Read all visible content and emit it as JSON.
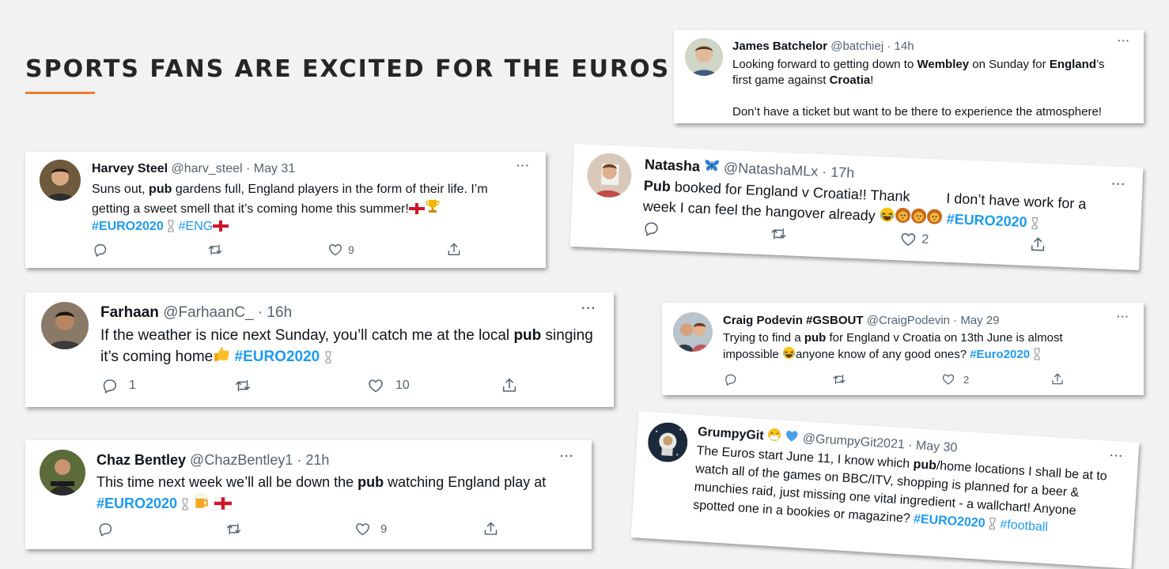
{
  "slide": {
    "title": "SPORTS FANS ARE EXCITED FOR THE EUROS",
    "accent_color": "#ed7d31"
  },
  "tweets": {
    "james": {
      "name": "James Batchelor",
      "handle": "@batchiej",
      "time": "· 14h",
      "t1": "Looking forward to getting down to ",
      "b1": "Wembley",
      "t2": " on Sunday for ",
      "b2": "England",
      "t3": "’s",
      "t4": "first game against ",
      "b3": "Croatia",
      "t5": "!",
      "line3": "Don’t have a ticket but want to be there to experience the atmosphere!"
    },
    "harvey": {
      "name": "Harvey Steel",
      "handle": "@harv_steel",
      "time": "· May 31",
      "t1": "Suns out, ",
      "b1": "pub",
      "t2": " gardens full, England players in the form of their life. I’m",
      "t3": "getting a sweet smell that it’s coming home this summer!",
      "hash1": "#EURO2020",
      "hash2": "#ENG",
      "likes": "9"
    },
    "natasha": {
      "name": "Natasha",
      "handle": "@NatashaMLx",
      "time": "· 17h",
      "b1": "Pub",
      "t1": " booked for England v Croatia!! Thank",
      "t2": "I don’t have work for a",
      "t3": "week I can feel the hangover already ",
      "hash1": "#EURO2020",
      "likes": "2"
    },
    "farhaan": {
      "name": "Farhaan",
      "handle": "@FarhaanC_",
      "time": "· 16h",
      "t1": "If the weather is nice next Sunday, you’ll catch me at the local ",
      "b1": "pub",
      "t2": " singing",
      "t3": "it’s coming home",
      "hash1": "#EURO2020",
      "replies": "1",
      "likes": "10"
    },
    "craig": {
      "name": "Craig Podevin #GSBOUT",
      "handle": "@CraigPodevin",
      "time": "· May 29",
      "t1": "Trying to find a ",
      "b1": "pub",
      "t2": " for England v Croatia on 13th June is almost",
      "t3": "impossible ",
      "t4": "anyone know of any good ones? ",
      "hash1": "#Euro2020",
      "likes": "2"
    },
    "chaz": {
      "name": "Chaz Bentley",
      "handle": "@ChazBentley1",
      "time": "· 21h",
      "t1": "This time next week we’ll all be down the ",
      "b1": "pub",
      "t2": " watching England play at",
      "hash1": "#EURO2020",
      "likes": "9"
    },
    "grumpy": {
      "name": "GrumpyGit",
      "handle": "@GrumpyGit2021",
      "time": "· May 30",
      "l1a": "The Euros start June 11, I know which ",
      "l1b": "pub",
      "l1c": "/home locations I shall be at to",
      "l2": "watch all of the games on BBC/ITV, shopping is planned for a beer &",
      "l3": "munchies raid, just missing one vital ingredient - a wallchart! Anyone",
      "l4": "spotted one in a bookies or magazine? ",
      "hash1": "#EURO2020",
      "hash2": "#football"
    }
  },
  "icons": [
    "reply-icon",
    "retweet-icon",
    "like-icon",
    "share-icon",
    "more-icon",
    "trophy-emoji",
    "england-flag-emoji",
    "thumbs-up-emoji",
    "laughing-emoji",
    "lion-emoji",
    "beer-emoji",
    "butterfly-emoji",
    "blue-heart-emoji",
    "mask-emoji"
  ],
  "colors": {
    "link": "#1d9bf0",
    "secondary": "#536471",
    "text": "#0f1419"
  }
}
